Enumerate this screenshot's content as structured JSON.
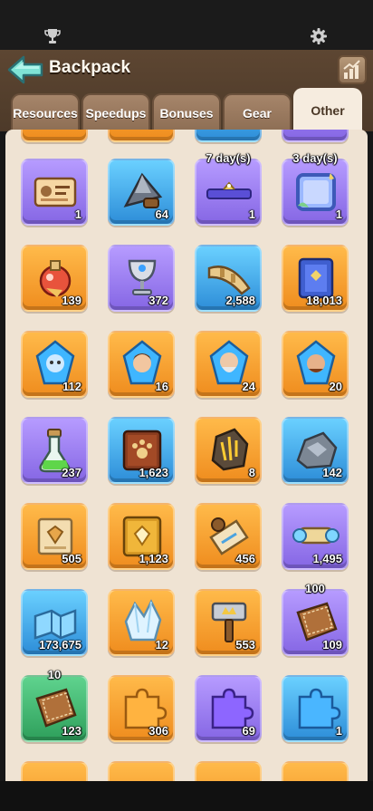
{
  "header": {
    "title": "Backpack"
  },
  "tabs": [
    {
      "label": "Resources",
      "active": false
    },
    {
      "label": "Speedups",
      "active": false
    },
    {
      "label": "Bonuses",
      "active": false
    },
    {
      "label": "Gear",
      "active": false
    },
    {
      "label": "Other",
      "active": true
    }
  ],
  "items": [
    {
      "icon": "id-card-icon",
      "color": "purple",
      "count": "1",
      "top_label": ""
    },
    {
      "icon": "pickaxe-head-icon",
      "color": "blue",
      "count": "64",
      "top_label": ""
    },
    {
      "icon": "nameplate-icon",
      "color": "purple",
      "count": "1",
      "top_label": "7 day(s)"
    },
    {
      "icon": "avatar-frame-icon",
      "color": "purple",
      "count": "1",
      "top_label": "3 day(s)"
    },
    {
      "icon": "potion-bottle-icon",
      "color": "orange",
      "count": "139",
      "top_label": ""
    },
    {
      "icon": "silver-chalice-icon",
      "color": "purple",
      "count": "372",
      "top_label": ""
    },
    {
      "icon": "war-horn-icon",
      "color": "blue",
      "count": "2,588",
      "top_label": ""
    },
    {
      "icon": "blue-tome-icon",
      "color": "orange",
      "count": "18,013",
      "top_label": ""
    },
    {
      "icon": "crystal-shard-ghost-icon",
      "color": "orange",
      "count": "112",
      "top_label": ""
    },
    {
      "icon": "crystal-shard-heroine-icon",
      "color": "orange",
      "count": "16",
      "top_label": ""
    },
    {
      "icon": "crystal-shard-elder-icon",
      "color": "orange",
      "count": "24",
      "top_label": ""
    },
    {
      "icon": "crystal-shard-warrior-icon",
      "color": "orange",
      "count": "20",
      "top_label": ""
    },
    {
      "icon": "green-vial-icon",
      "color": "purple",
      "count": "237",
      "top_label": ""
    },
    {
      "icon": "paw-book-icon",
      "color": "blue",
      "count": "1,623",
      "top_label": ""
    },
    {
      "icon": "gold-ore-icon",
      "color": "orange",
      "count": "8",
      "top_label": ""
    },
    {
      "icon": "stone-ore-icon",
      "color": "blue",
      "count": "142",
      "top_label": ""
    },
    {
      "icon": "diamond-scroll-icon",
      "color": "orange",
      "count": "505",
      "top_label": ""
    },
    {
      "icon": "gold-diamond-book-icon",
      "color": "orange",
      "count": "1,123",
      "top_label": ""
    },
    {
      "icon": "map-scrolls-icon",
      "color": "orange",
      "count": "456",
      "top_label": ""
    },
    {
      "icon": "rolled-scroll-icon",
      "color": "purple",
      "count": "1,495",
      "top_label": ""
    },
    {
      "icon": "blue-map-icon",
      "color": "blue",
      "count": "173,675",
      "top_label": ""
    },
    {
      "icon": "ice-crystal-icon",
      "color": "orange",
      "count": "12",
      "top_label": ""
    },
    {
      "icon": "crown-hammer-icon",
      "color": "orange",
      "count": "553",
      "top_label": ""
    },
    {
      "icon": "leather-patch-icon",
      "color": "purple",
      "count": "109",
      "top_label": "100"
    },
    {
      "icon": "leather-patch-icon",
      "color": "green",
      "count": "123",
      "top_label": "10"
    },
    {
      "icon": "orange-puzzle-icon",
      "color": "orange",
      "count": "306",
      "top_label": ""
    },
    {
      "icon": "purple-puzzle-icon",
      "color": "purple",
      "count": "69",
      "top_label": ""
    },
    {
      "icon": "blue-puzzle-icon",
      "color": "blue",
      "count": "1",
      "top_label": ""
    }
  ],
  "colors": {
    "purple": "#8a6cf0",
    "blue": "#3aa3e6",
    "orange": "#f5a02e",
    "green": "#3db56e",
    "panel": "#efe3d3",
    "header": "#553f2d"
  }
}
